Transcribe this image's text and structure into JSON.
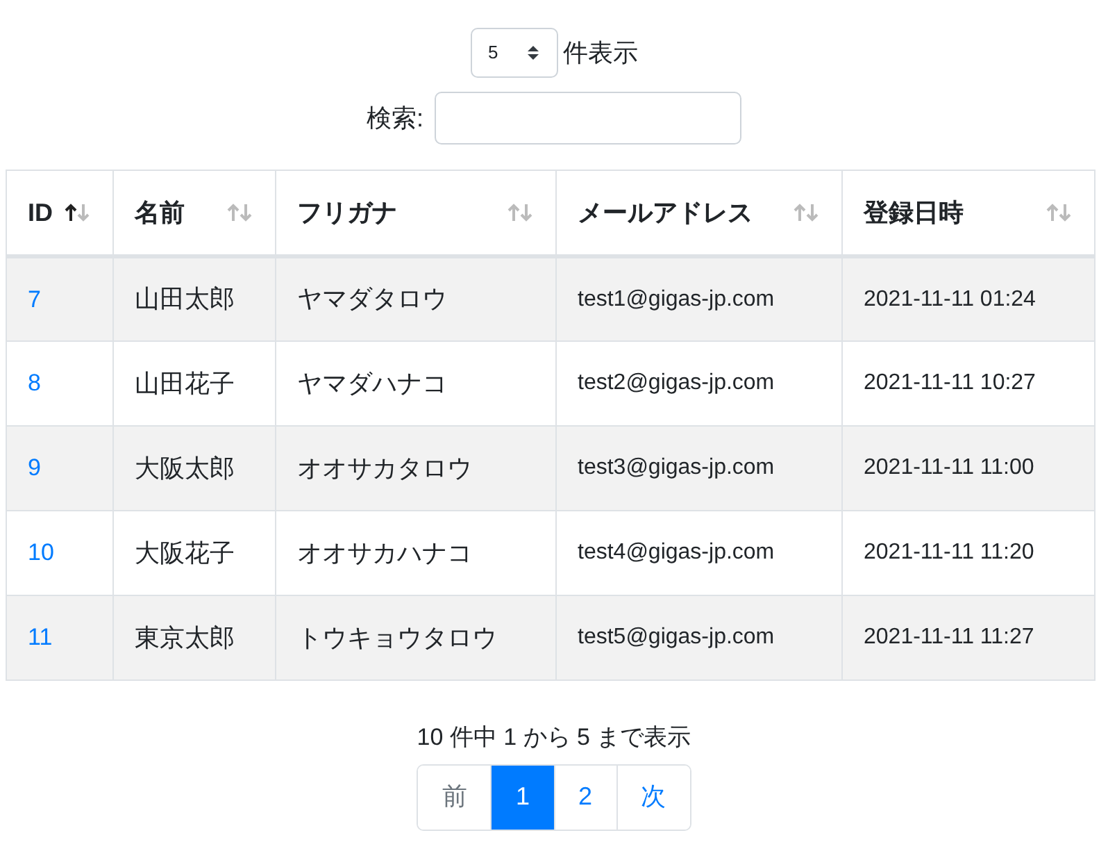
{
  "length_menu": {
    "value": "5",
    "label": "件表示"
  },
  "search": {
    "label": "検索:"
  },
  "table": {
    "columns": [
      {
        "label": "ID",
        "sorted_ascending": true
      },
      {
        "label": "名前",
        "sorted_ascending": false
      },
      {
        "label": "フリガナ",
        "sorted_ascending": false
      },
      {
        "label": "メールアドレス",
        "sorted_ascending": false
      },
      {
        "label": "登録日時",
        "sorted_ascending": false
      }
    ],
    "rows": [
      [
        "7",
        "山田太郎",
        "ヤマダタロウ",
        "test1@gigas-jp.com",
        "2021-11-11 01:24"
      ],
      [
        "8",
        "山田花子",
        "ヤマダハナコ",
        "test2@gigas-jp.com",
        "2021-11-11 10:27"
      ],
      [
        "9",
        "大阪太郎",
        "オオサカタロウ",
        "test3@gigas-jp.com",
        "2021-11-11 11:00"
      ],
      [
        "10",
        "大阪花子",
        "オオサカハナコ",
        "test4@gigas-jp.com",
        "2021-11-11 11:20"
      ],
      [
        "11",
        "東京太郎",
        "トウキョウタロウ",
        "test5@gigas-jp.com",
        "2021-11-11 11:27"
      ]
    ]
  },
  "info": "10 件中 1 から 5 まで表示",
  "pagination": [
    {
      "label": "前",
      "disabled": true,
      "selected": false
    },
    {
      "label": "1",
      "disabled": false,
      "selected": true
    },
    {
      "label": "2",
      "disabled": false,
      "selected": false
    },
    {
      "label": "次",
      "disabled": false,
      "selected": false
    }
  ]
}
